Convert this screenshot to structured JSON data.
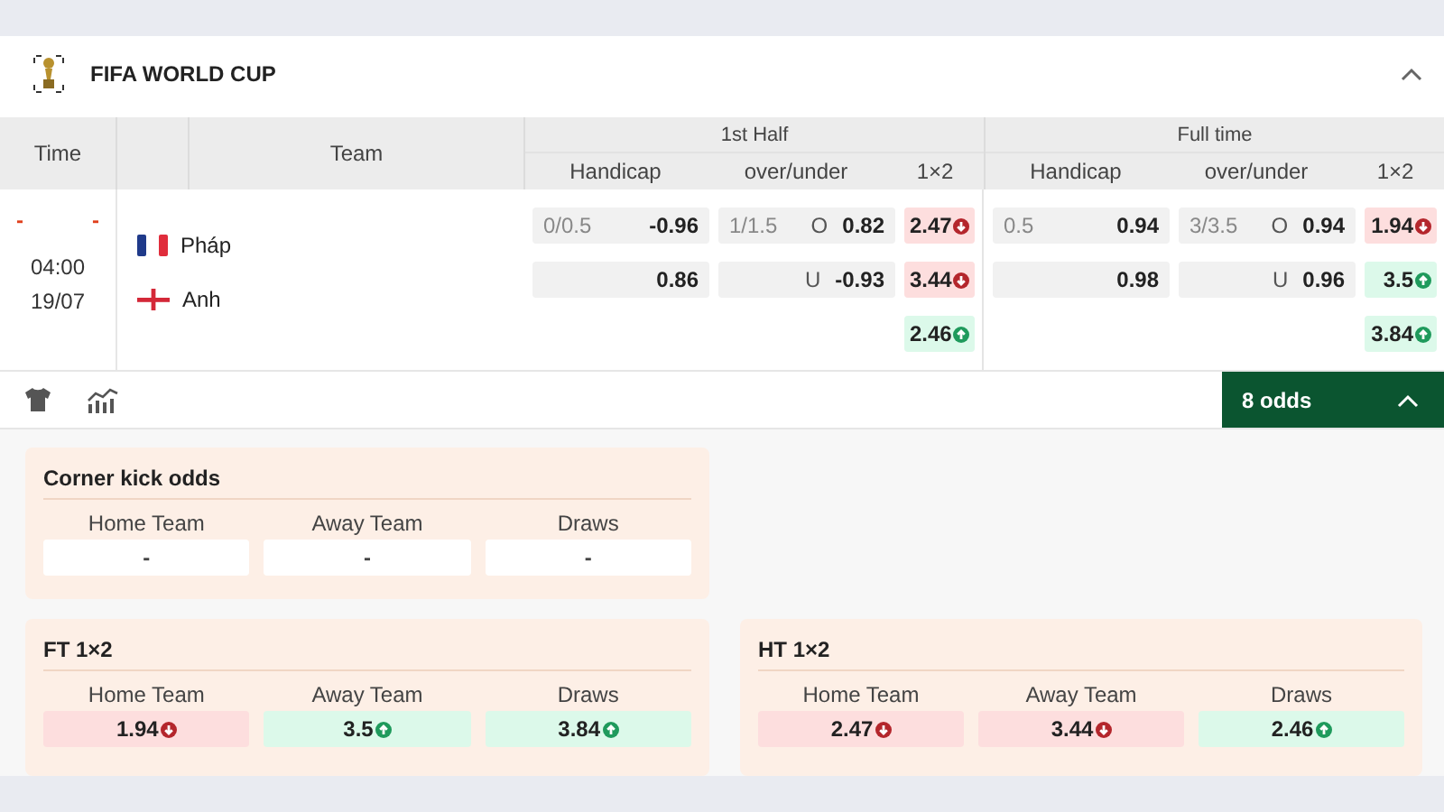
{
  "header": {
    "title": "FIFA WORLD CUP",
    "expanded": true
  },
  "table": {
    "columns": {
      "time": "Time",
      "team": "Team"
    },
    "groups": [
      {
        "title": "1st Half",
        "subcolumns": [
          "Handicap",
          "over/under",
          "1×2"
        ]
      },
      {
        "title": "Full time",
        "subcolumns": [
          "Handicap",
          "over/under",
          "1×2"
        ]
      }
    ]
  },
  "match": {
    "home_score": "-",
    "away_score": "-",
    "time": "04:00",
    "date": "19/07",
    "teams": [
      {
        "name": "Pháp",
        "kind": "france"
      },
      {
        "name": "Anh",
        "kind": "england"
      }
    ],
    "halves": [
      {
        "handicap": [
          {
            "line": "0/0.5",
            "value": "-0.96"
          },
          {
            "value": "0.86"
          }
        ],
        "over_under": [
          {
            "line": "1/1.5",
            "side": "O",
            "value": "0.82"
          },
          {
            "side": "U",
            "value": "-0.93"
          }
        ],
        "one_x_two": [
          {
            "value": "2.47",
            "rising": false
          },
          {
            "value": "3.44",
            "rising": false
          },
          {
            "value": "2.46",
            "rising": true
          }
        ]
      },
      {
        "handicap": [
          {
            "line": "0.5",
            "value": "0.94"
          },
          {
            "value": "0.98"
          }
        ],
        "over_under": [
          {
            "line": "3/3.5",
            "side": "O",
            "value": "0.94"
          },
          {
            "side": "U",
            "value": "0.96"
          }
        ],
        "one_x_two": [
          {
            "value": "1.94",
            "rising": false
          },
          {
            "value": "3.5",
            "rising": true
          },
          {
            "value": "3.84",
            "rising": true
          }
        ]
      }
    ]
  },
  "odds_button": {
    "label": "8 odds",
    "expanded": true
  },
  "cards": [
    {
      "title": "Corner kick odds",
      "selections": [
        {
          "label": "Home Team",
          "value": "-"
        },
        {
          "label": "Away Team",
          "value": "-"
        },
        {
          "label": "Draws",
          "value": "-"
        }
      ]
    },
    {
      "title": "FT 1×2",
      "selections": [
        {
          "label": "Home Team",
          "value": "1.94",
          "rising": false
        },
        {
          "label": "Away Team",
          "value": "3.5",
          "rising": true
        },
        {
          "label": "Draws",
          "value": "3.84",
          "rising": true
        }
      ]
    },
    {
      "title": "HT 1×2",
      "selections": [
        {
          "label": "Home Team",
          "value": "2.47",
          "rising": false
        },
        {
          "label": "Away Team",
          "value": "3.44",
          "rising": false
        },
        {
          "label": "Draws",
          "value": "2.46",
          "rising": true
        }
      ]
    }
  ]
}
